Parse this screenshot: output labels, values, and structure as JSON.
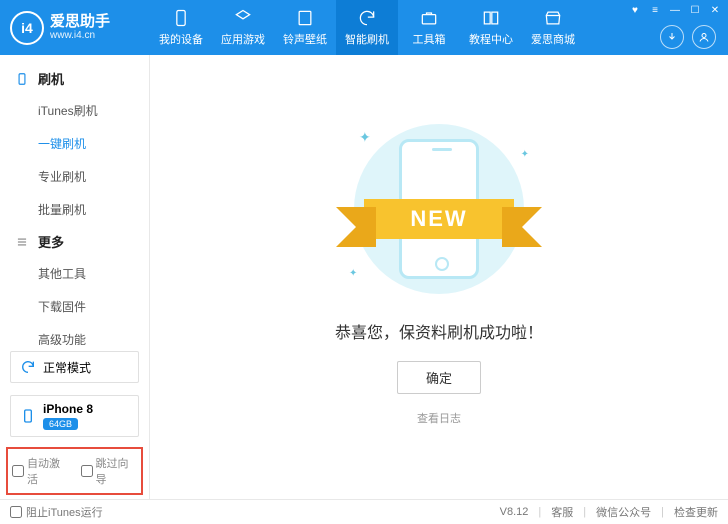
{
  "brand": {
    "logo_text": "i4",
    "name": "爱思助手",
    "url": "www.i4.cn"
  },
  "nav": [
    {
      "id": "devices",
      "label": "我的设备"
    },
    {
      "id": "apps",
      "label": "应用游戏"
    },
    {
      "id": "ringtone",
      "label": "铃声壁纸"
    },
    {
      "id": "flash",
      "label": "智能刷机"
    },
    {
      "id": "toolbox",
      "label": "工具箱"
    },
    {
      "id": "tutorial",
      "label": "教程中心"
    },
    {
      "id": "store",
      "label": "爱思商城"
    }
  ],
  "sidebar": {
    "sections": [
      {
        "title": "刷机",
        "items": [
          "iTunes刷机",
          "一键刷机",
          "专业刷机",
          "批量刷机"
        ],
        "active_index": 1
      },
      {
        "title": "更多",
        "items": [
          "其他工具",
          "下载固件",
          "高级功能"
        ]
      }
    ],
    "mode": "正常模式",
    "device": {
      "name": "iPhone 8",
      "storage": "64GB"
    },
    "footer_checks": [
      "自动激活",
      "跳过向导"
    ]
  },
  "main": {
    "ribbon": "NEW",
    "success_text": "恭喜您，保资料刷机成功啦！",
    "confirm": "确定",
    "log_link": "查看日志"
  },
  "status": {
    "block_itunes": "阻止iTunes运行",
    "version": "V8.12",
    "links": [
      "客服",
      "微信公众号",
      "检查更新"
    ]
  }
}
